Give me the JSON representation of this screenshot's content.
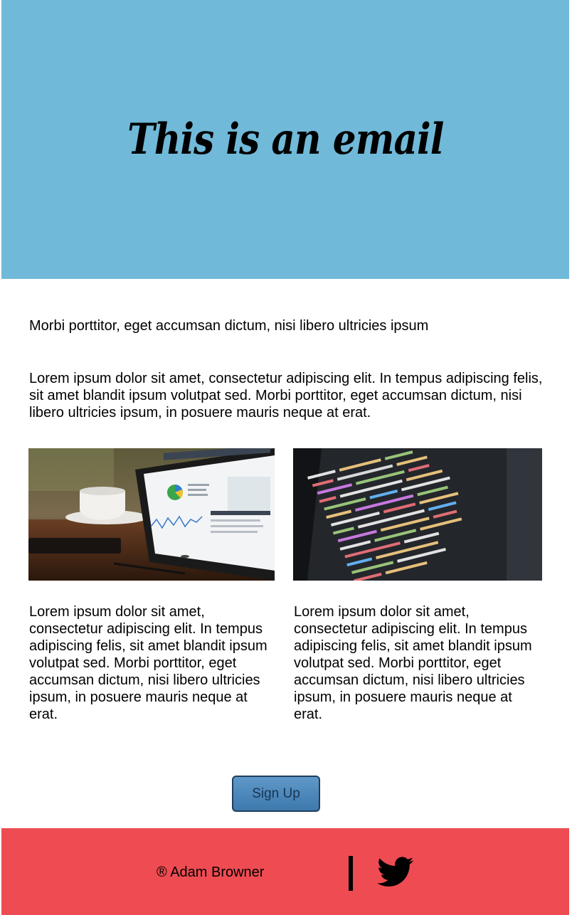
{
  "header": {
    "title": "This is an email"
  },
  "intro": {
    "text": "Morbi porttitor, eget accumsan dictum, nisi libero ultricies ipsum"
  },
  "lead": {
    "text": "Lorem ipsum dolor sit amet, consectetur adipiscing elit. In tempus adipiscing felis, sit amet blandit ipsum volutpat sed. Morbi porttitor, eget accumsan dictum, nisi libero ultricies ipsum, in posuere mauris neque at erat."
  },
  "cards": [
    {
      "image": "tablet-dashboard-photo",
      "text": "Lorem ipsum dolor sit amet, consectetur adipiscing elit. In tempus adipiscing felis, sit amet blandit ipsum volutpat sed. Morbi porttitor, eget accumsan dictum, nisi libero ultricies ipsum, in posuere mauris neque at erat."
    },
    {
      "image": "code-screen-photo",
      "text": "Lorem ipsum dolor sit amet, consectetur adipiscing elit. In tempus adipiscing felis, sit amet blandit ipsum volutpat sed. Morbi porttitor, eget accumsan dictum, nisi libero ultricies ipsum, in posuere mauris neque at erat."
    }
  ],
  "cta": {
    "label": "Sign Up"
  },
  "footer": {
    "copyright": "® Adam Browner",
    "social_icon": "twitter-icon"
  },
  "colors": {
    "hero_background": "#70b9d9",
    "footer_background": "#ee4c52",
    "button_background": "#4a86ba"
  }
}
